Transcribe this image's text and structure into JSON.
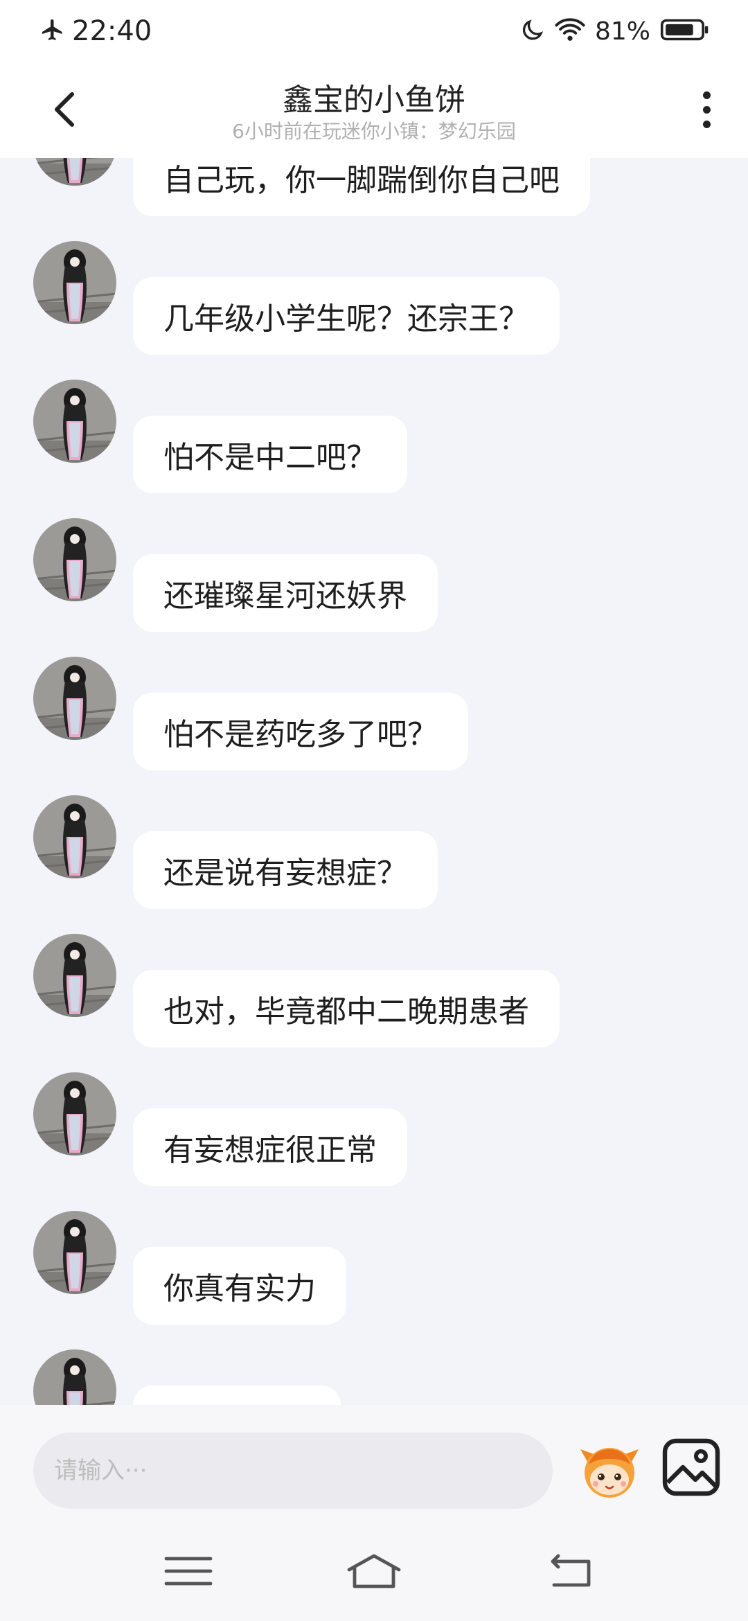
{
  "status_bar": {
    "time": "22:40",
    "battery_percent": "81%",
    "icons": [
      "airplane-icon",
      "moon-icon",
      "wifi-icon",
      "battery-icon"
    ]
  },
  "header": {
    "title": "鑫宝的小鱼饼",
    "subtitle": "6小时前在玩迷你小镇：梦幻乐园"
  },
  "messages": [
    {
      "text": "自己玩，你一脚踹倒你自己吧"
    },
    {
      "text": "几年级小学生呢？还宗王？"
    },
    {
      "text": "怕不是中二吧？"
    },
    {
      "text": "还璀璨星河还妖界"
    },
    {
      "text": "怕不是药吃多了吧？"
    },
    {
      "text": "还是说有妄想症？"
    },
    {
      "text": "也对，毕竟都中二晚期患者"
    },
    {
      "text": "有妄想症很正常"
    },
    {
      "text": "你真有实力"
    },
    {
      "text": ""
    }
  ],
  "input": {
    "placeholder": "请输入···",
    "value": ""
  },
  "colors": {
    "chat_background": "#f2f4f9",
    "bubble": "#ffffff",
    "header": "#ffffff",
    "input_background": "#ebebef",
    "placeholder": "#bdbdbd",
    "subtitle": "#b0b0b0"
  }
}
